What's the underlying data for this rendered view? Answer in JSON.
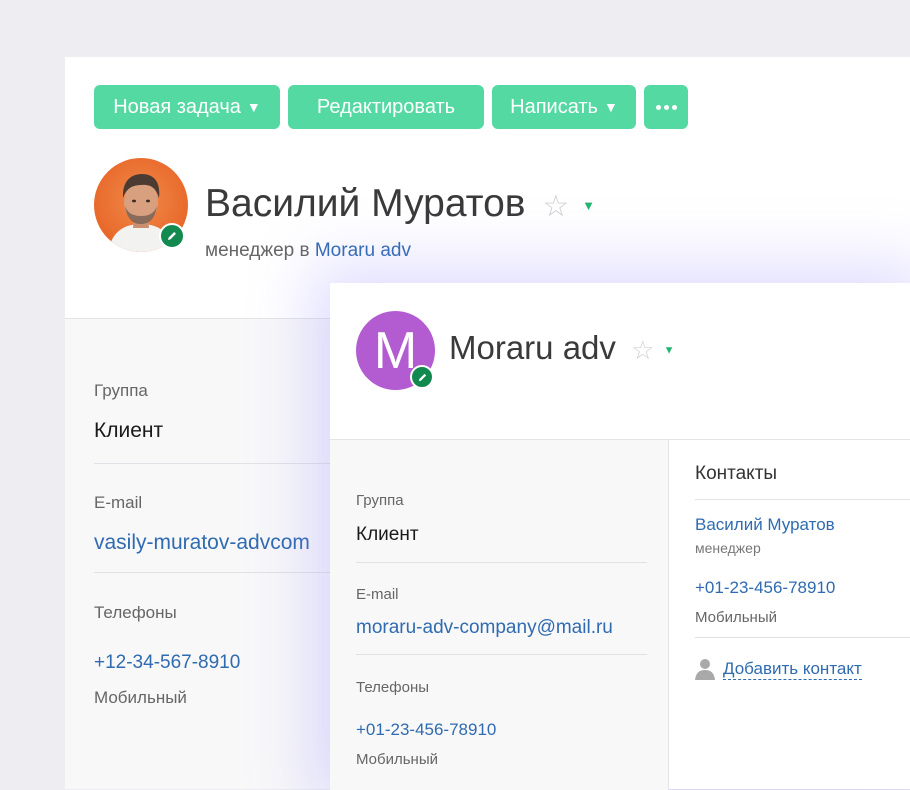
{
  "toolbar": {
    "new_task": "Новая задача",
    "edit": "Редактировать",
    "write": "Написать",
    "more_icon": "more-dots-icon"
  },
  "person": {
    "name": "Василий Муратов",
    "position_prefix": "менеджер в",
    "company": "Moraru adv",
    "group_label": "Группа",
    "group_value": "Клиент",
    "email_label": "E-mail",
    "email_value": "vasily-muratov-advcom",
    "phones_label": "Телефоны",
    "phone_value": "+12-34-567-8910",
    "phone_type": "Мобильный"
  },
  "company": {
    "avatar_letter": "M",
    "name": "Moraru adv",
    "group_label": "Группа",
    "group_value": "Клиент",
    "email_label": "E-mail",
    "email_value": "moraru-adv-company@mail.ru",
    "phones_label": "Телефоны",
    "phone_value": "+01-23-456-78910",
    "phone_type": "Мобильный",
    "contacts": {
      "title": "Контакты",
      "person_name": "Василий Муратов",
      "person_role": "менеджер",
      "person_phone": "+01-23-456-78910",
      "person_phone_type": "Мобильный",
      "add_contact": "Добавить контакт"
    }
  },
  "colors": {
    "button": "#55d9a2",
    "link": "#2f6bb0",
    "badge": "#12894f",
    "company_avatar": "#b35bd0",
    "person_avatar_bg": "#e8692a"
  }
}
